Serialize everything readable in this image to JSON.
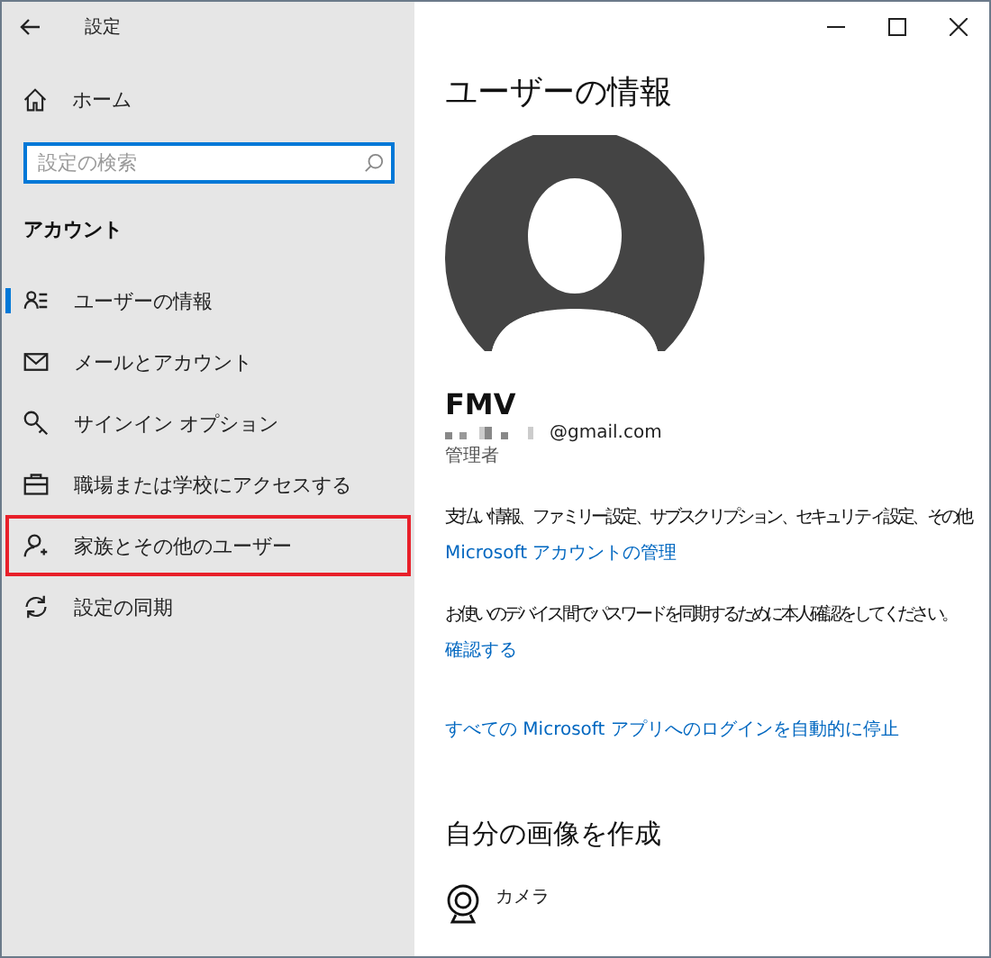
{
  "window": {
    "title": "設定",
    "controls": [
      {
        "kind": "minimize"
      },
      {
        "kind": "maximize"
      },
      {
        "kind": "close"
      }
    ]
  },
  "sidebar": {
    "home": "ホーム",
    "search": {
      "placeholder": "設定の検索"
    },
    "section": "アカウント",
    "items": [
      {
        "label": "ユーザーの情報",
        "kind": "user-list",
        "selected": true,
        "highlighted": false
      },
      {
        "label": "メールとアカウント",
        "kind": "mail",
        "selected": false,
        "highlighted": false
      },
      {
        "label": "サインイン オプション",
        "kind": "key",
        "selected": false,
        "highlighted": false
      },
      {
        "label": "職場または学校にアクセスする",
        "kind": "briefcase",
        "selected": false,
        "highlighted": false
      },
      {
        "label": "家族とその他のユーザー",
        "kind": "user-add",
        "selected": false,
        "highlighted": true
      },
      {
        "label": "設定の同期",
        "kind": "sync",
        "selected": false,
        "highlighted": false
      }
    ]
  },
  "content": {
    "title": "ユーザーの情報",
    "user": {
      "name": "FMV",
      "email": "@gmail.com",
      "role": "管理者"
    },
    "blocks": [
      {
        "text": "支払い情報、ファミリー設定、サブスクリプション、セキュリティ設定、その他",
        "link": "Microsoft アカウントの管理"
      },
      {
        "text": "お使いのデバイス間でパスワードを同期するために本人確認をしてください。",
        "link": "確認する"
      },
      {
        "link": "すべての Microsoft アプリへのログインを自動的に停止"
      }
    ],
    "create_title": "自分の画像を作成",
    "create_items": [
      {
        "label": "カメラ"
      }
    ]
  }
}
